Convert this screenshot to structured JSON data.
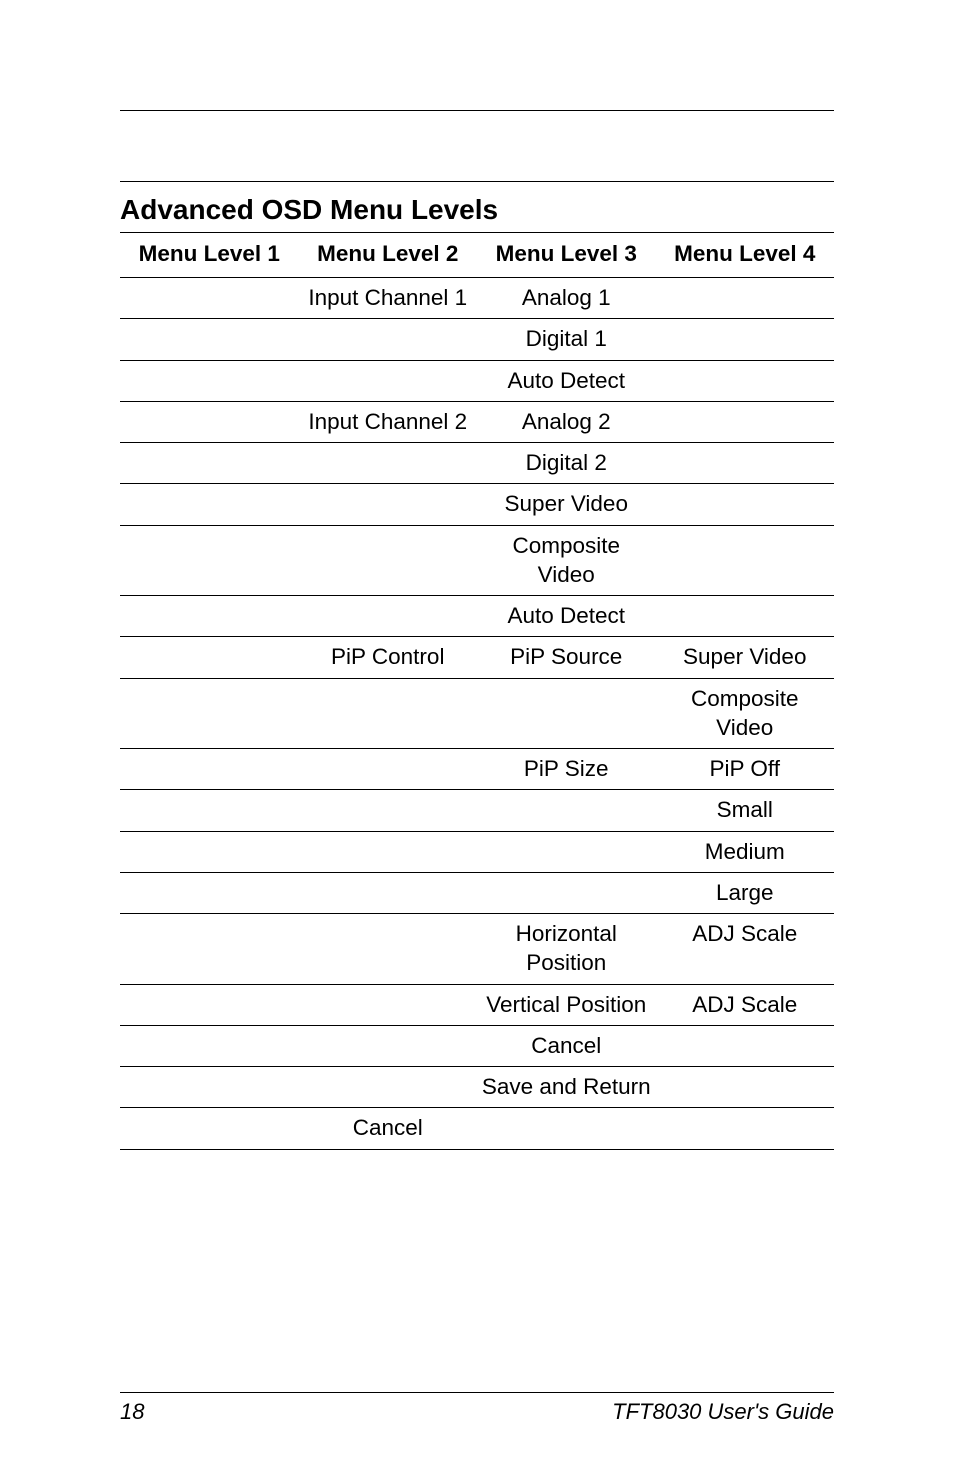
{
  "section_title": "Advanced OSD Menu Levels",
  "headers": [
    "Menu Level 1",
    "Menu Level 2",
    "Menu Level 3",
    "Menu Level 4"
  ],
  "rows": [
    {
      "c1": "",
      "c2": "Input Channel 1",
      "c3": "Analog 1",
      "c4": ""
    },
    {
      "c1": "",
      "c2": "",
      "c3": "Digital 1",
      "c4": ""
    },
    {
      "c1": "",
      "c2": "",
      "c3": "Auto Detect",
      "c4": ""
    },
    {
      "c1": "",
      "c2": "Input Channel 2",
      "c3": "Analog 2",
      "c4": ""
    },
    {
      "c1": "",
      "c2": "",
      "c3": "Digital 2",
      "c4": ""
    },
    {
      "c1": "",
      "c2": "",
      "c3": "Super Video",
      "c4": ""
    },
    {
      "c1": "",
      "c2": "",
      "c3": "Composite Video",
      "c4": ""
    },
    {
      "c1": "",
      "c2": "",
      "c3": "Auto Detect",
      "c4": ""
    },
    {
      "c1": "",
      "c2": "PiP Control",
      "c3": "PiP Source",
      "c4": "Super Video"
    },
    {
      "c1": "",
      "c2": "",
      "c3": "",
      "c4": "Composite Video"
    },
    {
      "c1": "",
      "c2": "",
      "c3": "PiP Size",
      "c4": "PiP Off"
    },
    {
      "c1": "",
      "c2": "",
      "c3": "",
      "c4": "Small"
    },
    {
      "c1": "",
      "c2": "",
      "c3": "",
      "c4": "Medium"
    },
    {
      "c1": "",
      "c2": "",
      "c3": "",
      "c4": "Large"
    },
    {
      "c1": "",
      "c2": "",
      "c3": "Horizontal Position",
      "c4": "ADJ Scale"
    },
    {
      "c1": "",
      "c2": "",
      "c3": "Vertical Position",
      "c4": "ADJ Scale"
    },
    {
      "c1": "",
      "c2": "",
      "c3": "Cancel",
      "c4": ""
    },
    {
      "c1": "",
      "c2": "",
      "c3": "Save and Return",
      "c4": ""
    },
    {
      "c1": "",
      "c2": "Cancel",
      "c3": "",
      "c4": ""
    }
  ],
  "footer": {
    "page": "18",
    "guide": "TFT8030 User's Guide"
  }
}
